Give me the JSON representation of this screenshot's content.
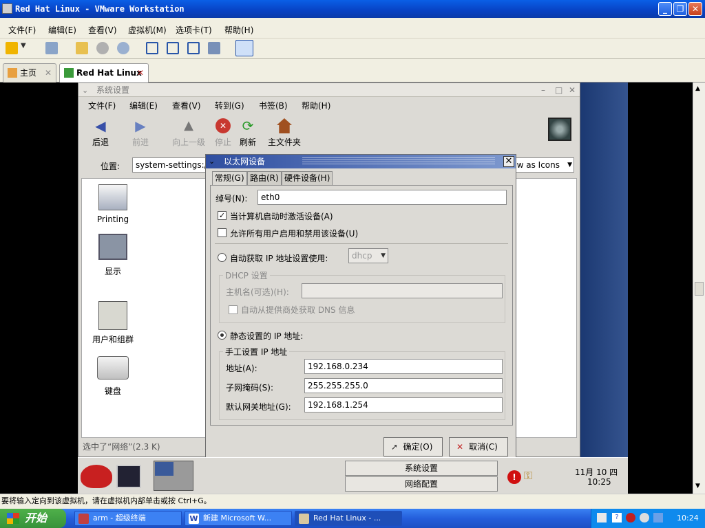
{
  "vmware": {
    "title": "Red Hat Linux - VMware Workstation",
    "menu": [
      "文件(F)",
      "编辑(E)",
      "查看(V)",
      "虚拟机(M)",
      "选项卡(T)",
      "帮助(H)"
    ],
    "tabs": [
      {
        "label": "主页"
      },
      {
        "label": "Red Hat Linux"
      }
    ],
    "status": "要将输入定向到该虚拟机，请在虚拟机内部单击或按 Ctrl+G。"
  },
  "nautilus": {
    "title": "系统设置",
    "menu": [
      "文件(F)",
      "编辑(E)",
      "查看(V)",
      "转到(G)",
      "书签(B)",
      "帮助(H)"
    ],
    "toolbar": [
      "后退",
      "前进",
      "向上一级",
      "停止",
      "刷新",
      "主文件夹"
    ],
    "location_label": "位置:",
    "location_value": "system-settings:///",
    "view_as": "w as Icons",
    "icons": [
      "Printing",
      "显示",
      "用户和组群",
      "键盘"
    ],
    "status": "选中了“网络”(2.3 K)"
  },
  "dialog": {
    "title": "以太网设备",
    "tabs": [
      "常规(G)",
      "路由(R)",
      "硬件设备(H)"
    ],
    "nickname_label": "绰号(N):",
    "nickname_value": "eth0",
    "activate_on_boot": "当计算机启动时激活设备(A)",
    "allow_users": "允许所有用户启用和禁用该设备(U)",
    "auto_ip_label": "自动获取 IP 地址设置使用:",
    "auto_ip_method": "dhcp",
    "dhcp_group": "DHCP 设置",
    "hostname_label": "主机名(可选)(H):",
    "dns_label": "自动从提供商处获取 DNS 信息",
    "static_label": "静态设置的 IP 地址:",
    "manual_group": "手工设置 IP 地址",
    "address_label": "地址(A):",
    "address_value": "192.168.0.234",
    "netmask_label": "子网掩码(S):",
    "netmask_value": "255.255.255.0",
    "gateway_label": "默认网关地址(G):",
    "gateway_value": "192.168.1.254",
    "ok": "确定(O)",
    "cancel": "取消(C)"
  },
  "panel": {
    "tasks": [
      "系统设置",
      "网络配置"
    ],
    "clock_date": "11月 10 四",
    "clock_time": "10:25"
  },
  "taskbar": {
    "start": "开始",
    "items": [
      "arm - 超级终端",
      "新建 Microsoft W...",
      "Red Hat Linux - ..."
    ],
    "time": "10:24"
  }
}
